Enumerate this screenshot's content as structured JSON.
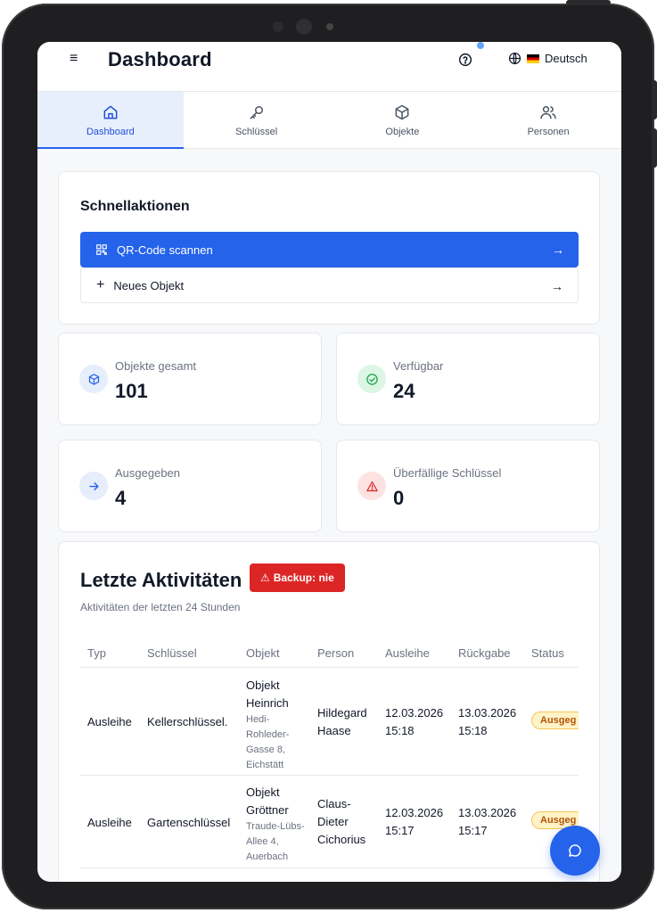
{
  "header": {
    "title": "Dashboard",
    "language": "Deutsch"
  },
  "tabs": [
    {
      "label": "Dashboard",
      "icon": "home-icon",
      "active": true
    },
    {
      "label": "Schlüssel",
      "icon": "key-icon",
      "active": false
    },
    {
      "label": "Objekte",
      "icon": "box-icon",
      "active": false
    },
    {
      "label": "Personen",
      "icon": "users-icon",
      "active": false
    }
  ],
  "quick_actions": {
    "title": "Schnellaktionen",
    "scan_label": "QR-Code scannen",
    "new_object_label": "Neues Objekt"
  },
  "stats": {
    "total": {
      "label": "Objekte gesamt",
      "value": "101",
      "color": "#2563eb"
    },
    "available": {
      "label": "Verfügbar",
      "value": "24",
      "color": "#16a34a"
    },
    "issued": {
      "label": "Ausgegeben",
      "value": "4",
      "color": "#2563eb"
    },
    "overdue": {
      "label": "Überfällige Schlüssel",
      "value": "0",
      "color": "#dc2626"
    }
  },
  "activity": {
    "title": "Letzte Aktivitäten",
    "backup_badge": "Backup: nie",
    "subtitle": "Aktivitäten der letzten 24 Stunden",
    "columns": [
      "Typ",
      "Schlüssel",
      "Objekt",
      "Person",
      "Ausleihe",
      "Rückgabe",
      "Status"
    ],
    "rows": [
      {
        "typ": "Ausleihe",
        "schluessel": "Kellerschlüssel.",
        "objekt": "Objekt Heinrich",
        "adresse": "Hedi-Rohleder-Gasse 8, Eichstätt",
        "person": "Hildegard Haase",
        "ausleihe": "12.03.2026 15:18",
        "rueckgabe": "13.03.2026 15:18",
        "status": "Ausgeg"
      },
      {
        "typ": "Ausleihe",
        "schluessel": "Gartenschlüssel",
        "objekt": "Objekt Gröttner",
        "adresse": "Traude-Lübs-Allee 4, Auerbach",
        "person": "Claus-Dieter Cichorius",
        "ausleihe": "12.03.2026 15:17",
        "rueckgabe": "13.03.2026 15:17",
        "status": "Ausgeg"
      }
    ]
  },
  "colors": {
    "primary": "#2563eb",
    "danger": "#dc2626",
    "success": "#16a34a",
    "warning": "#f6c453"
  }
}
